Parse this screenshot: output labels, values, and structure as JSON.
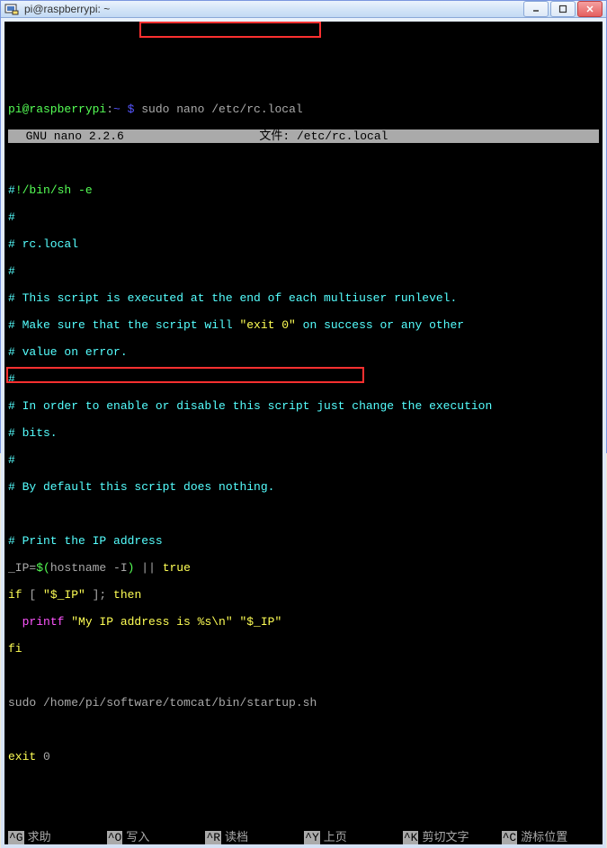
{
  "titlebar": {
    "title": "pi@raspberrypi: ~"
  },
  "prompt": {
    "userhost": "pi@raspberrypi",
    "colon": ":",
    "path": "~ $",
    "command": " sudo nano /etc/rc.local"
  },
  "nano": {
    "version": "  GNU nano 2.2.6",
    "file_label": "文件: ",
    "file_path": "/etc/rc.local"
  },
  "script": {
    "shebang_hash": "#",
    "shebang_rest": "!/bin/sh -e",
    "h2": "#",
    "c_rc": "# rc.local",
    "h4": "#",
    "c_l1": "# This script is executed at the end of each multiuser runlevel.",
    "c_l2a": "# Make sure that the script will ",
    "c_l2b": "\"exit 0\"",
    "c_l2c": " on success or any other",
    "c_l3": "# value on error.",
    "h8": "#",
    "c_l4": "# In order to enable or disable this script just change the execution",
    "c_l5": "# bits.",
    "h11": "#",
    "c_l6": "# By default this script does nothing.",
    "c_ip": "# Print the IP address",
    "ip_var": "_IP",
    "ip_eq": "=",
    "ip_dollar": "$(",
    "ip_cmd": "hostname -I",
    "ip_close": ")",
    "ip_or": " || ",
    "ip_true": "true",
    "if_kw": "if",
    "if_cond": " [ ",
    "if_var": "\"$_IP\"",
    "if_cond2": " ]; ",
    "then_kw": "then",
    "printf_indent": "  ",
    "printf_kw": "printf",
    "printf_arg1": " \"My IP address is %s\\n\"",
    "printf_arg2": " \"$_IP\"",
    "fi_kw": "fi",
    "startup": "sudo /home/pi/software/tomcat/bin/startup.sh",
    "exit_kw": "exit",
    "exit_code": " 0"
  },
  "footer": {
    "i1k": "^G",
    "i1l": "求助",
    "i2k": "^O",
    "i2l": "写入",
    "i3k": "^R",
    "i3l": "读档",
    "i4k": "^Y",
    "i4l": "上页",
    "i5k": "^K",
    "i5l": "剪切文字",
    "i6k": "^C",
    "i6l": "游标位置"
  }
}
